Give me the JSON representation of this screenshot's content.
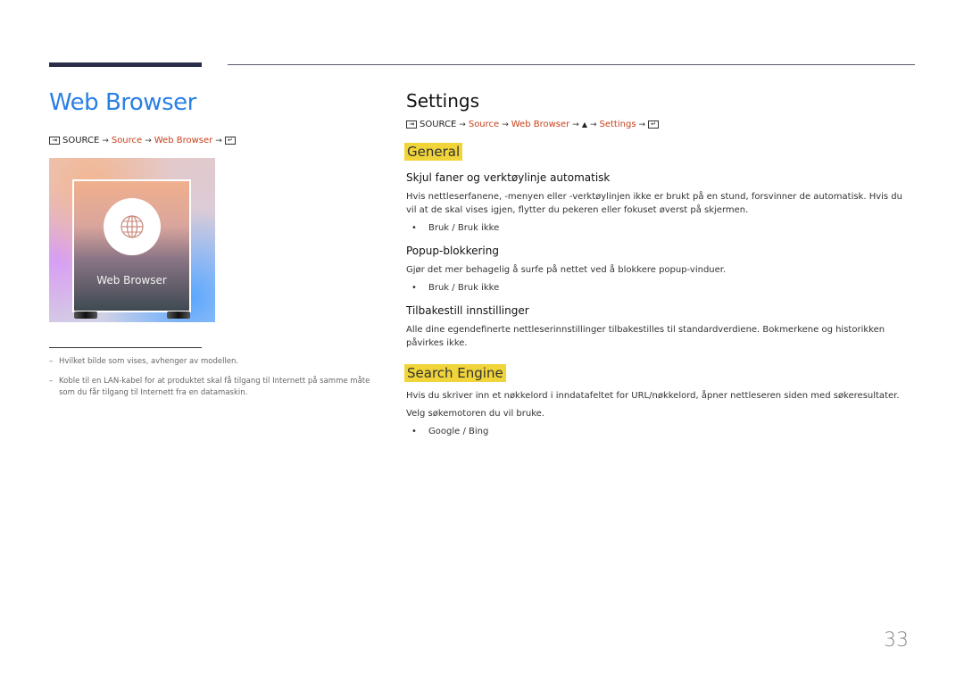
{
  "left": {
    "title": "Web Browser",
    "path": {
      "icon_start": "source-icon",
      "source": "SOURCE",
      "steps": [
        "Source",
        "Web Browser"
      ],
      "icon_end": "enter-icon"
    },
    "thumbnail": {
      "icon": "globe-icon",
      "label": "Web Browser"
    },
    "notes": [
      "Hvilket bilde som vises, avhenger av modellen.",
      "Koble til en LAN-kabel for at produktet skal få tilgang til Internett på samme måte som du får tilgang til Internett fra en datamaskin."
    ]
  },
  "right": {
    "title": "Settings",
    "path": {
      "icon_start": "source-icon",
      "source": "SOURCE",
      "step1": "Source",
      "step2": "Web Browser",
      "up_icon": "▲",
      "step3": "Settings",
      "icon_end": "enter-icon"
    },
    "general": {
      "heading": "General",
      "items": [
        {
          "title": "Skjul faner og verktøylinje automatisk",
          "text": "Hvis nettleserfanene, -menyen eller -verktøylinjen ikke er brukt på en stund, forsvinner de automatisk. Hvis du vil at de skal vises igjen, flytter du pekeren eller fokuset øverst på skjermen.",
          "option": "Bruk / Bruk ikke"
        },
        {
          "title": "Popup-blokkering",
          "text": "Gjør det mer behagelig å surfe på nettet ved å blokkere popup-vinduer.",
          "option": "Bruk / Bruk ikke"
        },
        {
          "title": "Tilbakestill innstillinger",
          "text": "Alle dine egendefinerte nettleserinnstillinger tilbakestilles til standardverdiene. Bokmerkene og historikken påvirkes ikke."
        }
      ]
    },
    "search_engine": {
      "heading": "Search Engine",
      "text1": "Hvis du skriver inn et nøkkelord i inndatafeltet for URL/nøkkelord, åpner nettleseren siden med søkeresultater.",
      "text2": "Velg søkemotoren du vil bruke.",
      "option": "Google / Bing"
    }
  },
  "arrow": "→",
  "bullet": "•",
  "dash": "–",
  "page_number": "33",
  "colors": {
    "title_blue": "#2a7fe6",
    "path_red": "#c8401a",
    "highlight_yellow": "#f0d43a",
    "bar_navy": "#2b2e48"
  }
}
